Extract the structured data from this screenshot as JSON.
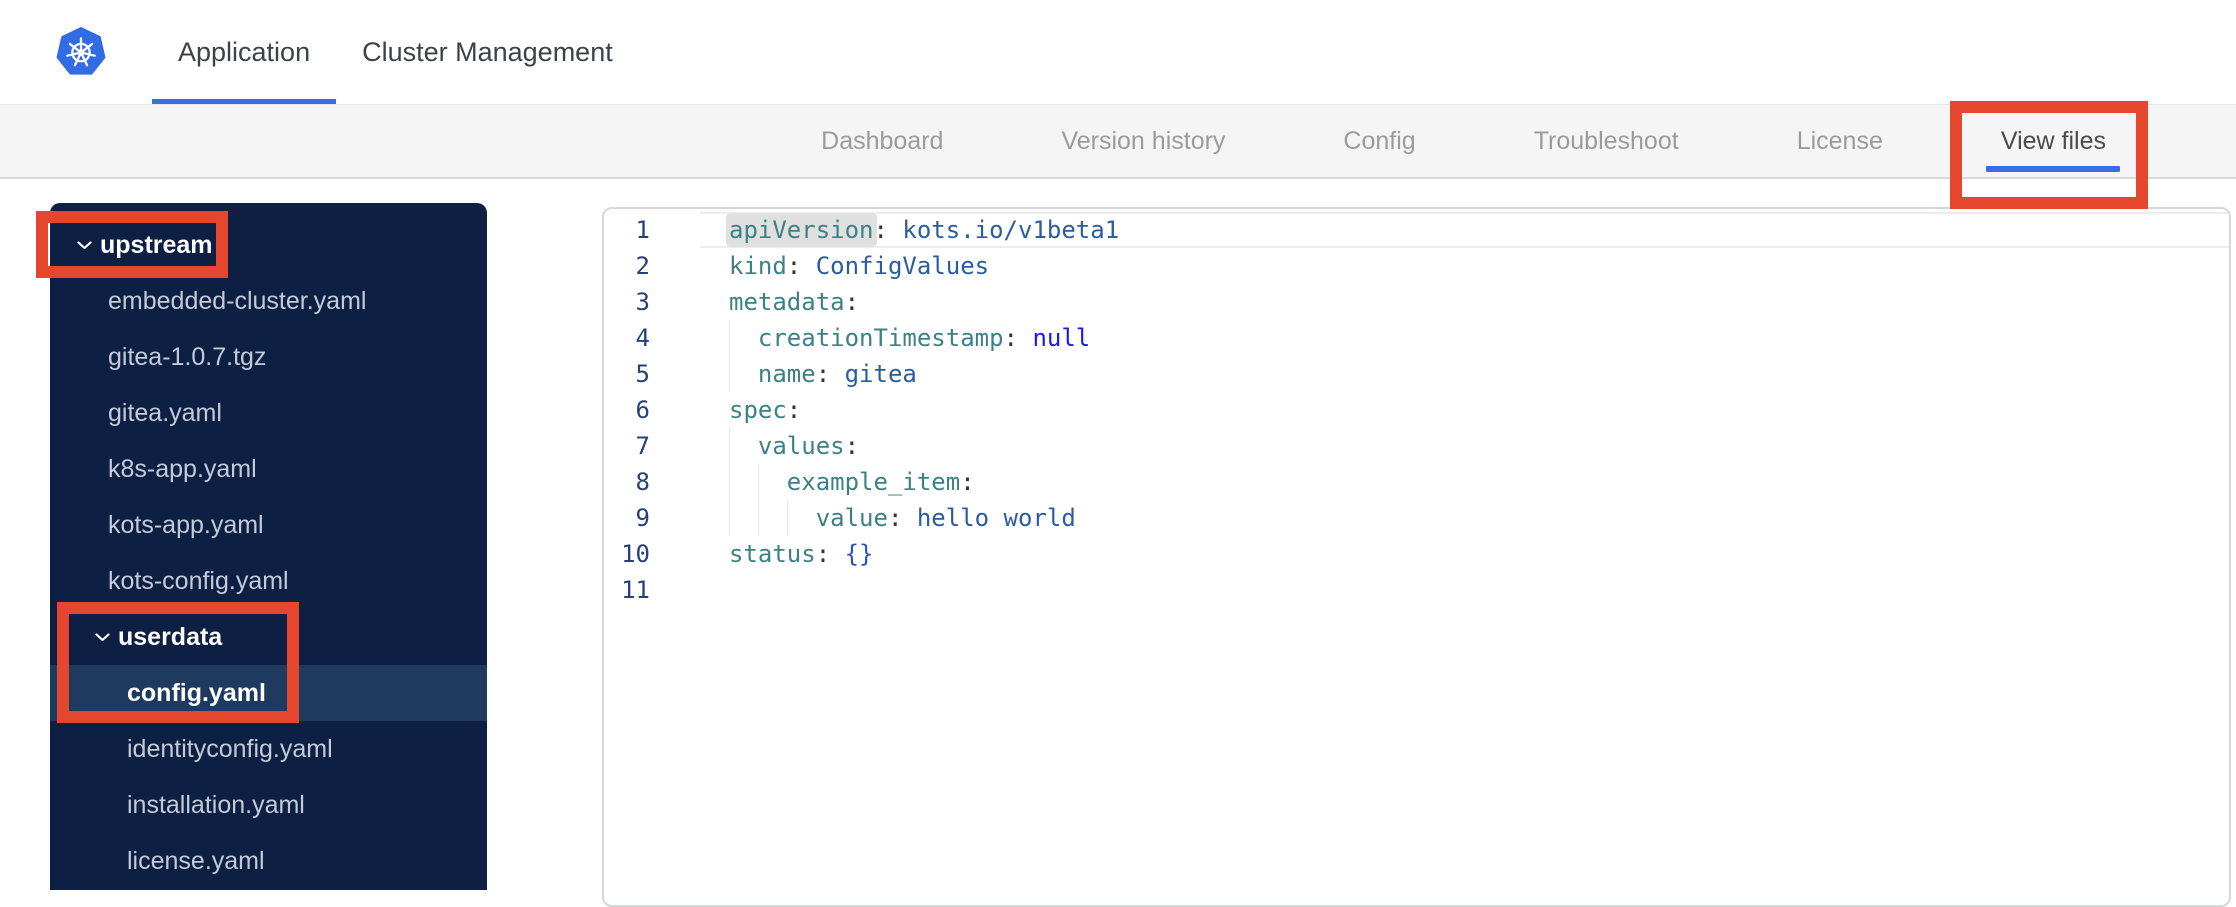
{
  "topbar": {
    "logo_icon": "kubernetes-helm-logo",
    "tabs": [
      {
        "label": "Application",
        "active": true
      },
      {
        "label": "Cluster Management",
        "active": false
      }
    ]
  },
  "navbar": {
    "tabs": [
      {
        "label": "Dashboard",
        "active": false
      },
      {
        "label": "Version history",
        "active": false
      },
      {
        "label": "Config",
        "active": false
      },
      {
        "label": "Troubleshoot",
        "active": false
      },
      {
        "label": "License",
        "active": false
      },
      {
        "label": "View files",
        "active": true
      }
    ]
  },
  "sidebar": {
    "items": [
      {
        "label": "upstream",
        "kind": "folder",
        "depth": 0,
        "expanded": true,
        "selected": false
      },
      {
        "label": "embedded-cluster.yaml",
        "kind": "file",
        "depth": 1,
        "selected": false
      },
      {
        "label": "gitea-1.0.7.tgz",
        "kind": "file",
        "depth": 1,
        "selected": false
      },
      {
        "label": "gitea.yaml",
        "kind": "file",
        "depth": 1,
        "selected": false
      },
      {
        "label": "k8s-app.yaml",
        "kind": "file",
        "depth": 1,
        "selected": false
      },
      {
        "label": "kots-app.yaml",
        "kind": "file",
        "depth": 1,
        "selected": false
      },
      {
        "label": "kots-config.yaml",
        "kind": "file",
        "depth": 1,
        "selected": false
      },
      {
        "label": "userdata",
        "kind": "folder",
        "depth": 1,
        "expanded": true,
        "selected": false
      },
      {
        "label": "config.yaml",
        "kind": "file",
        "depth": 2,
        "selected": true
      },
      {
        "label": "identityconfig.yaml",
        "kind": "file",
        "depth": 2,
        "selected": false
      },
      {
        "label": "installation.yaml",
        "kind": "file",
        "depth": 2,
        "selected": false
      },
      {
        "label": "license.yaml",
        "kind": "file",
        "depth": 2,
        "selected": false
      }
    ]
  },
  "editor": {
    "lines": [
      {
        "num": 1,
        "current": true,
        "tokens": [
          {
            "text": "apiVersion",
            "type": "key",
            "highlight": true
          },
          {
            "text": ":",
            "type": "punct"
          },
          {
            "text": " kots.io/v1beta1",
            "type": "value"
          }
        ]
      },
      {
        "num": 2,
        "tokens": [
          {
            "text": "kind",
            "type": "key"
          },
          {
            "text": ":",
            "type": "punct"
          },
          {
            "text": " ConfigValues",
            "type": "value"
          }
        ]
      },
      {
        "num": 3,
        "tokens": [
          {
            "text": "metadata",
            "type": "key"
          },
          {
            "text": ":",
            "type": "punct"
          }
        ]
      },
      {
        "num": 4,
        "guides": [
          0
        ],
        "tokens": [
          {
            "text": "  ",
            "type": "plain"
          },
          {
            "text": "creationTimestamp",
            "type": "key"
          },
          {
            "text": ":",
            "type": "punct"
          },
          {
            "text": " ",
            "type": "plain"
          },
          {
            "text": "null",
            "type": "constant"
          }
        ]
      },
      {
        "num": 5,
        "guides": [
          0
        ],
        "tokens": [
          {
            "text": "  ",
            "type": "plain"
          },
          {
            "text": "name",
            "type": "key"
          },
          {
            "text": ":",
            "type": "punct"
          },
          {
            "text": " gitea",
            "type": "value"
          }
        ]
      },
      {
        "num": 6,
        "tokens": [
          {
            "text": "spec",
            "type": "key"
          },
          {
            "text": ":",
            "type": "punct"
          }
        ]
      },
      {
        "num": 7,
        "guides": [
          0
        ],
        "tokens": [
          {
            "text": "  ",
            "type": "plain"
          },
          {
            "text": "values",
            "type": "key"
          },
          {
            "text": ":",
            "type": "punct"
          }
        ]
      },
      {
        "num": 8,
        "guides": [
          0,
          2
        ],
        "tokens": [
          {
            "text": "    ",
            "type": "plain"
          },
          {
            "text": "example_item",
            "type": "key"
          },
          {
            "text": ":",
            "type": "punct"
          }
        ]
      },
      {
        "num": 9,
        "guides": [
          0,
          2,
          4
        ],
        "tokens": [
          {
            "text": "      ",
            "type": "plain"
          },
          {
            "text": "value",
            "type": "key"
          },
          {
            "text": ":",
            "type": "punct"
          },
          {
            "text": " hello world",
            "type": "value"
          }
        ]
      },
      {
        "num": 10,
        "tokens": [
          {
            "text": "status",
            "type": "key"
          },
          {
            "text": ":",
            "type": "punct"
          },
          {
            "text": " ",
            "type": "plain"
          },
          {
            "text": "{}",
            "type": "bracket"
          }
        ]
      },
      {
        "num": 11,
        "tokens": []
      }
    ]
  },
  "annotations": [
    {
      "name": "upstream-folder-highlight",
      "target": "upstream"
    },
    {
      "name": "userdata-config-highlight",
      "target": "userdata / config.yaml"
    },
    {
      "name": "view-files-tab-highlight",
      "target": "View files"
    }
  ],
  "colors": {
    "kubernetes_blue": "#326ce5",
    "active_tab_underline": "#3b6de6",
    "annotation_red": "#e5472e",
    "navbar_bg": "#f5f5f6",
    "nav_inactive": "#9b9b9b",
    "nav_active": "#4b4b4b",
    "sidebar_bg": "#0d1f42",
    "sidebar_selected_bg": "#1e3b5f",
    "sidebar_file_text": "#c3cbd8",
    "sidebar_folder_text": "#ffffff",
    "code_key": "#3d8186",
    "code_value": "#2b5d9e",
    "code_constant": "#1a1af0",
    "code_bracket": "#2d51cc",
    "code_punct": "#333333",
    "line_number": "#27407a",
    "word_highlight_bg": "#e0e0e0"
  }
}
